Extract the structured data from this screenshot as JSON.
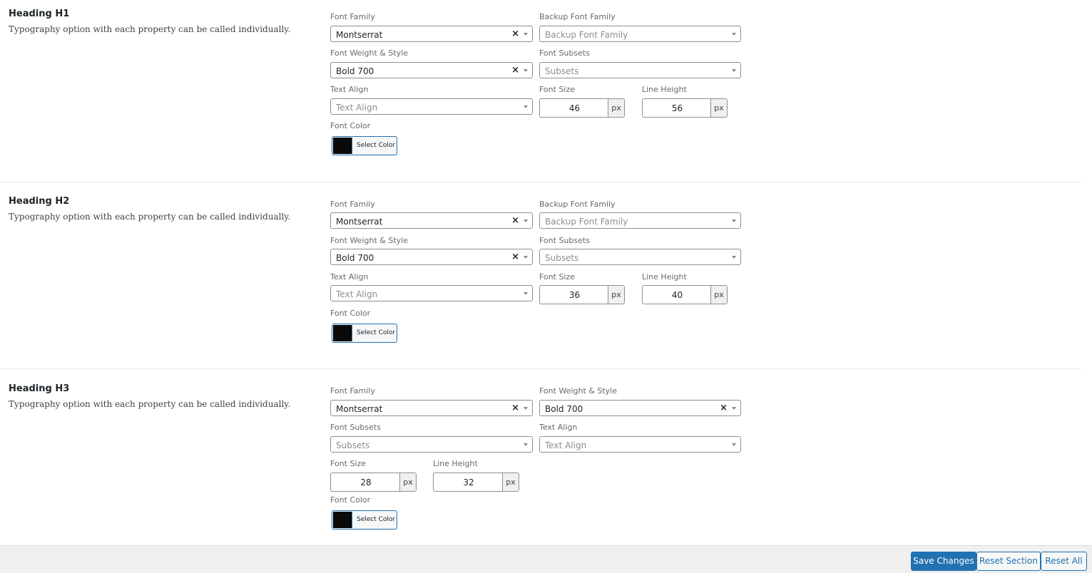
{
  "sections": [
    {
      "title": "Heading H1",
      "description": "Typography option with each property can be called individually.",
      "font_family": {
        "label": "Font Family",
        "value": "Montserrat"
      },
      "backup_font_family": {
        "label": "Backup Font Family",
        "placeholder": "Backup Font Family"
      },
      "font_weight": {
        "label": "Font Weight & Style",
        "value": "Bold 700"
      },
      "font_subsets": {
        "label": "Font Subsets",
        "placeholder": "Subsets"
      },
      "text_align": {
        "label": "Text Align",
        "placeholder": "Text Align"
      },
      "font_size": {
        "label": "Font Size",
        "value": "46",
        "unit": "px"
      },
      "line_height": {
        "label": "Line Height",
        "value": "56",
        "unit": "px"
      },
      "font_color": {
        "label": "Font Color",
        "button": "Select Color",
        "swatch": "#0a0a0a"
      }
    },
    {
      "title": "Heading H2",
      "description": "Typography option with each property can be called individually.",
      "font_family": {
        "label": "Font Family",
        "value": "Montserrat"
      },
      "backup_font_family": {
        "label": "Backup Font Family",
        "placeholder": "Backup Font Family"
      },
      "font_weight": {
        "label": "Font Weight & Style",
        "value": "Bold 700"
      },
      "font_subsets": {
        "label": "Font Subsets",
        "placeholder": "Subsets"
      },
      "text_align": {
        "label": "Text Align",
        "placeholder": "Text Align"
      },
      "font_size": {
        "label": "Font Size",
        "value": "36",
        "unit": "px"
      },
      "line_height": {
        "label": "Line Height",
        "value": "40",
        "unit": "px"
      },
      "font_color": {
        "label": "Font Color",
        "button": "Select Color",
        "swatch": "#0a0a0a"
      }
    },
    {
      "title": "Heading H3",
      "description": "Typography option with each property can be called individually.",
      "font_family": {
        "label": "Font Family",
        "value": "Montserrat"
      },
      "font_weight": {
        "label": "Font Weight & Style",
        "value": "Bold 700"
      },
      "font_subsets": {
        "label": "Font Subsets",
        "placeholder": "Subsets"
      },
      "text_align": {
        "label": "Text Align",
        "placeholder": "Text Align"
      },
      "font_size": {
        "label": "Font Size",
        "value": "28",
        "unit": "px"
      },
      "line_height": {
        "label": "Line Height",
        "value": "32",
        "unit": "px"
      },
      "font_color": {
        "label": "Font Color",
        "button": "Select Color",
        "swatch": "#0a0a0a"
      }
    }
  ],
  "footer": {
    "save_label": "Save Changes",
    "reset_section_label": "Reset Section",
    "reset_all_label": "Reset All"
  },
  "colors": {
    "primary": "#2271b1",
    "footer_bg": "#f0f0f1"
  }
}
